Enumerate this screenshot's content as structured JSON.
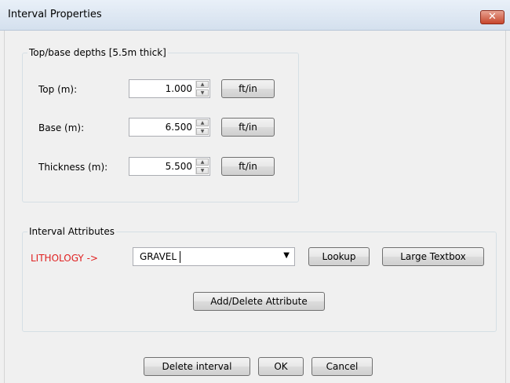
{
  "window": {
    "title": "Interval Properties",
    "close_glyph": "✕"
  },
  "depths": {
    "legend": "Top/base depths  [5.5m thick]",
    "rows": [
      {
        "label": "Top (m):",
        "value": "1.000",
        "unit_button": "ft/in"
      },
      {
        "label": "Base (m):",
        "value": "6.500",
        "unit_button": "ft/in"
      },
      {
        "label": "Thickness (m):",
        "value": "5.500",
        "unit_button": "ft/in"
      }
    ]
  },
  "attributes": {
    "legend": "Interval Attributes",
    "attribute_label": "LITHOLOGY ->",
    "attribute_value": "GRAVEL",
    "lookup_label": "Lookup",
    "large_textbox_label": "Large Textbox",
    "add_delete_label": "Add/Delete Attribute"
  },
  "footer": {
    "delete_label": "Delete interval",
    "ok_label": "OK",
    "cancel_label": "Cancel"
  },
  "colors": {
    "attribute_label": "#e02020",
    "titlebar": "#dce6f2"
  },
  "icons": {
    "spin_up": "spin-up-icon",
    "spin_down": "spin-down-icon",
    "dropdown": "dropdown-arrow-icon"
  }
}
